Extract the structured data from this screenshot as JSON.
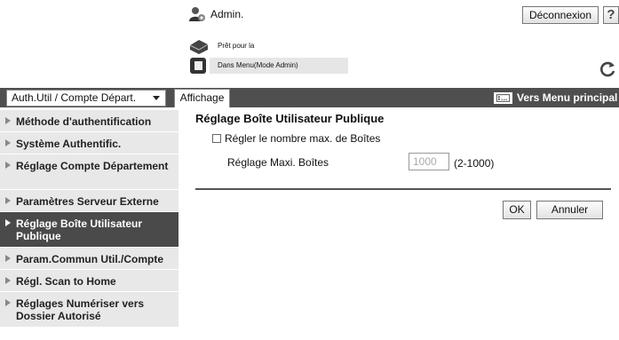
{
  "header": {
    "user_name": "Admin.",
    "logout_label": "Déconnexion",
    "help_label": "?",
    "icons": {
      "user": "admin-user-icon",
      "help": "help-icon",
      "refresh": "refresh-icon"
    }
  },
  "status": {
    "lines": [
      {
        "text": "Prêt pour la lecture",
        "icon": "scanner-icon"
      },
      {
        "text": "Dans Menu(Mode Admin)",
        "icon": "printer-icon"
      }
    ]
  },
  "navbar": {
    "category_select": "Auth.Util / Compte Départ.",
    "tab_label": "Affichage",
    "main_menu_label": "Vers Menu principal",
    "main_menu_icon": "menu-screen-icon"
  },
  "sidebar": {
    "items": [
      {
        "label": "Méthode d'authentification",
        "active": false
      },
      {
        "label": "Système Authentific.",
        "active": false
      },
      {
        "label": "Réglage Compte Département",
        "active": false
      },
      {
        "label": "Paramètres Serveur Externe",
        "active": false
      },
      {
        "label": "Réglage Boîte Utilisateur Publique",
        "active": true
      },
      {
        "label": "Param.Commun Util./Compte",
        "active": false
      },
      {
        "label": "Régl. Scan to Home",
        "active": false
      },
      {
        "label": "Réglages Numériser vers Dossier Autorisé",
        "active": false
      }
    ]
  },
  "main": {
    "title": "Réglage Boîte Utilisateur Publique",
    "checkbox_label": "Régler le nombre max. de Boîtes",
    "checkbox_checked": false,
    "max_boxes_label": "Réglage Maxi. Boîtes",
    "max_boxes_value": "1000",
    "range_hint": "(2-1000)",
    "ok_label": "OK",
    "cancel_label": "Annuler"
  },
  "colors": {
    "navbar_bg": "#4f4f4f",
    "sidebar_item_bg": "#e8e8e8",
    "sidebar_active_bg": "#4a4a4a",
    "status_bar_bg": "#e6e6e6"
  }
}
